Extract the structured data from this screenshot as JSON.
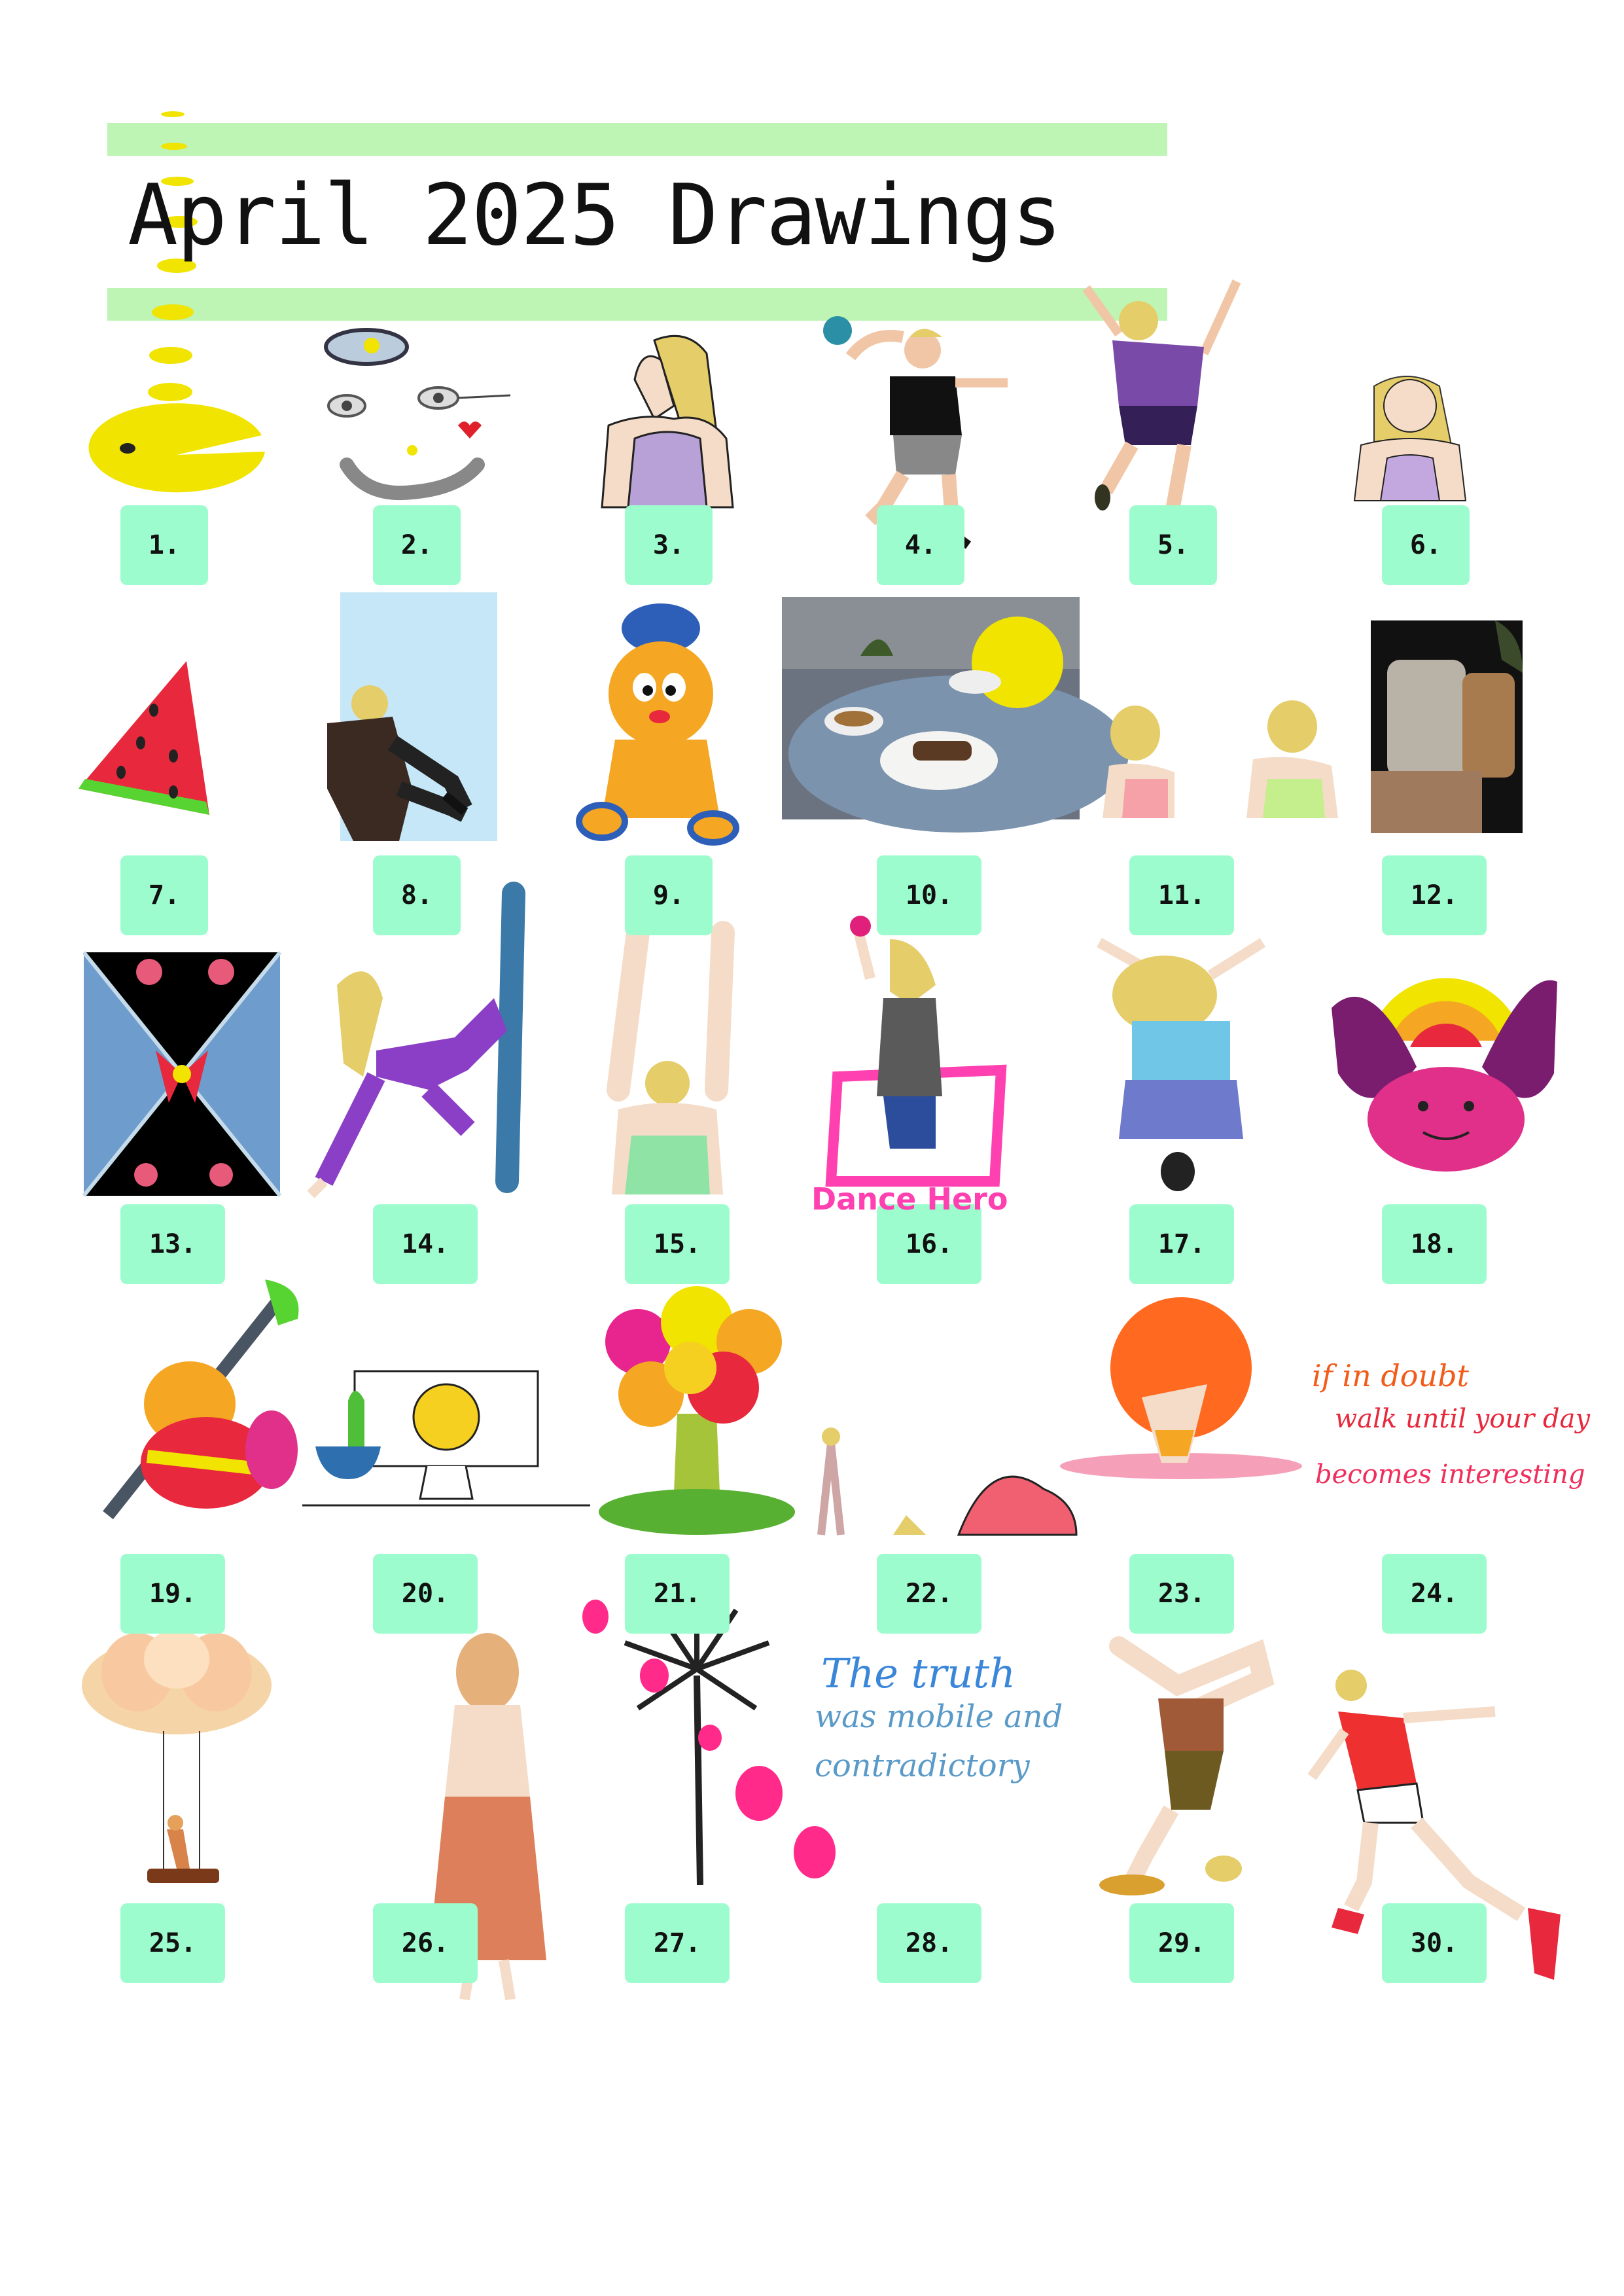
{
  "title": "April 2025 Drawings",
  "colors": {
    "band": "#bef5b4",
    "label": "#9dfccd",
    "pacman": "#f0e400"
  },
  "days": [
    "1.",
    "2.",
    "3.",
    "4.",
    "5.",
    "6.",
    "7.",
    "8.",
    "9.",
    "10.",
    "11.",
    "12.",
    "13.",
    "14.",
    "15.",
    "16.",
    "17.",
    "18.",
    "19.",
    "20.",
    "21.",
    "22.",
    "23.",
    "24.",
    "25.",
    "26.",
    "27.",
    "28.",
    "29.",
    "30."
  ],
  "annotations": {
    "dance_hero": "Dance Hero",
    "doubt_line1": "if in doubt",
    "doubt_line2": "walk until your day",
    "doubt_line3": "becomes interesting",
    "truth_line1": "The truth",
    "truth_line2": "was mobile and",
    "truth_line3": "contradictory"
  }
}
